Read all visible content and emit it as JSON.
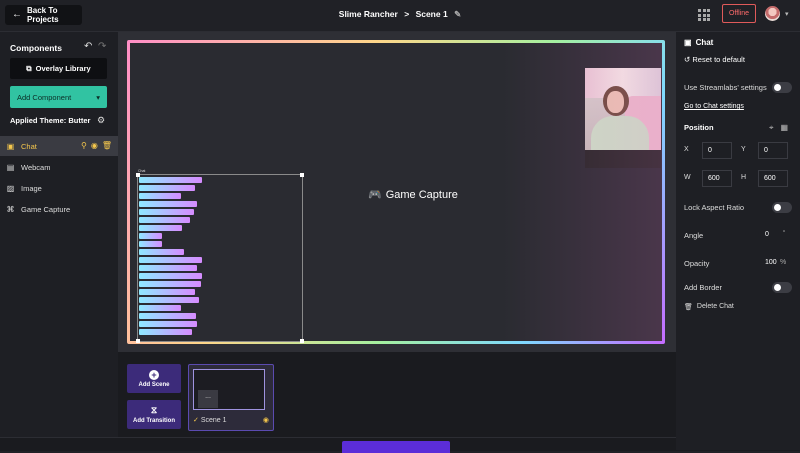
{
  "topbar": {
    "back_label": "Back To Projects",
    "project": "Slime Rancher",
    "separator": ">",
    "scene": "Scene 1",
    "status": "Offline"
  },
  "left": {
    "title": "Components",
    "overlay_library": "Overlay Library",
    "add_component": "Add Component",
    "applied_theme": "Applied Theme: Butter",
    "items": [
      {
        "label": "Chat",
        "icon": "chat-icon"
      },
      {
        "label": "Webcam",
        "icon": "webcam-icon"
      },
      {
        "label": "Image",
        "icon": "image-icon"
      },
      {
        "label": "Game Capture",
        "icon": "gamepad-icon"
      }
    ]
  },
  "canvas": {
    "game_capture_label": "Game Capture",
    "chat_tag": "Chat"
  },
  "scenes": {
    "add_scene": "Add Scene",
    "add_transition": "Add Transition",
    "scene_name": "Scene 1",
    "more": "..."
  },
  "right": {
    "title": "Chat",
    "reset": "Reset to default",
    "use_streamlabs": "Use Streamlabs' settings",
    "chat_settings_link": "Go to Chat settings",
    "position": "Position",
    "x_label": "X",
    "x_value": "0",
    "y_label": "Y",
    "y_value": "0",
    "w_label": "W",
    "w_value": "600",
    "h_label": "H",
    "h_value": "600",
    "lock_aspect": "Lock Aspect Ratio",
    "angle": "Angle",
    "angle_value": "0",
    "opacity": "Opacity",
    "opacity_value": "100",
    "opacity_unit": "%",
    "add_border": "Add Border",
    "delete": "Delete Chat"
  },
  "colors": {
    "accent_teal": "#31c3a2",
    "active_yellow": "#f5c74c",
    "offline_red": "#e05a5a",
    "scene_purple": "#3c2b7a"
  }
}
